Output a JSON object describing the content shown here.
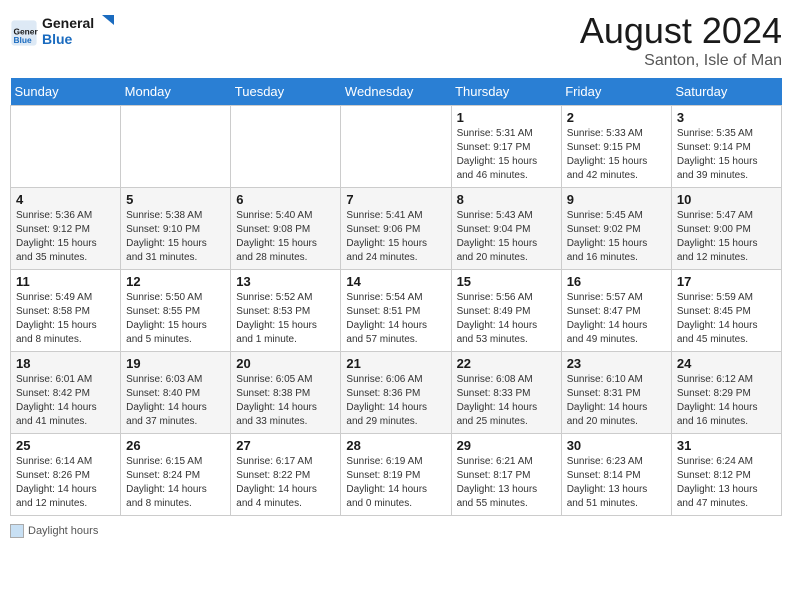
{
  "header": {
    "logo_line1": "General",
    "logo_line2": "Blue",
    "month_title": "August 2024",
    "subtitle": "Santon, Isle of Man"
  },
  "days_of_week": [
    "Sunday",
    "Monday",
    "Tuesday",
    "Wednesday",
    "Thursday",
    "Friday",
    "Saturday"
  ],
  "weeks": [
    [
      {
        "day": "",
        "info": ""
      },
      {
        "day": "",
        "info": ""
      },
      {
        "day": "",
        "info": ""
      },
      {
        "day": "",
        "info": ""
      },
      {
        "day": "1",
        "info": "Sunrise: 5:31 AM\nSunset: 9:17 PM\nDaylight: 15 hours\nand 46 minutes."
      },
      {
        "day": "2",
        "info": "Sunrise: 5:33 AM\nSunset: 9:15 PM\nDaylight: 15 hours\nand 42 minutes."
      },
      {
        "day": "3",
        "info": "Sunrise: 5:35 AM\nSunset: 9:14 PM\nDaylight: 15 hours\nand 39 minutes."
      }
    ],
    [
      {
        "day": "4",
        "info": "Sunrise: 5:36 AM\nSunset: 9:12 PM\nDaylight: 15 hours\nand 35 minutes."
      },
      {
        "day": "5",
        "info": "Sunrise: 5:38 AM\nSunset: 9:10 PM\nDaylight: 15 hours\nand 31 minutes."
      },
      {
        "day": "6",
        "info": "Sunrise: 5:40 AM\nSunset: 9:08 PM\nDaylight: 15 hours\nand 28 minutes."
      },
      {
        "day": "7",
        "info": "Sunrise: 5:41 AM\nSunset: 9:06 PM\nDaylight: 15 hours\nand 24 minutes."
      },
      {
        "day": "8",
        "info": "Sunrise: 5:43 AM\nSunset: 9:04 PM\nDaylight: 15 hours\nand 20 minutes."
      },
      {
        "day": "9",
        "info": "Sunrise: 5:45 AM\nSunset: 9:02 PM\nDaylight: 15 hours\nand 16 minutes."
      },
      {
        "day": "10",
        "info": "Sunrise: 5:47 AM\nSunset: 9:00 PM\nDaylight: 15 hours\nand 12 minutes."
      }
    ],
    [
      {
        "day": "11",
        "info": "Sunrise: 5:49 AM\nSunset: 8:58 PM\nDaylight: 15 hours\nand 8 minutes."
      },
      {
        "day": "12",
        "info": "Sunrise: 5:50 AM\nSunset: 8:55 PM\nDaylight: 15 hours\nand 5 minutes."
      },
      {
        "day": "13",
        "info": "Sunrise: 5:52 AM\nSunset: 8:53 PM\nDaylight: 15 hours\nand 1 minute."
      },
      {
        "day": "14",
        "info": "Sunrise: 5:54 AM\nSunset: 8:51 PM\nDaylight: 14 hours\nand 57 minutes."
      },
      {
        "day": "15",
        "info": "Sunrise: 5:56 AM\nSunset: 8:49 PM\nDaylight: 14 hours\nand 53 minutes."
      },
      {
        "day": "16",
        "info": "Sunrise: 5:57 AM\nSunset: 8:47 PM\nDaylight: 14 hours\nand 49 minutes."
      },
      {
        "day": "17",
        "info": "Sunrise: 5:59 AM\nSunset: 8:45 PM\nDaylight: 14 hours\nand 45 minutes."
      }
    ],
    [
      {
        "day": "18",
        "info": "Sunrise: 6:01 AM\nSunset: 8:42 PM\nDaylight: 14 hours\nand 41 minutes."
      },
      {
        "day": "19",
        "info": "Sunrise: 6:03 AM\nSunset: 8:40 PM\nDaylight: 14 hours\nand 37 minutes."
      },
      {
        "day": "20",
        "info": "Sunrise: 6:05 AM\nSunset: 8:38 PM\nDaylight: 14 hours\nand 33 minutes."
      },
      {
        "day": "21",
        "info": "Sunrise: 6:06 AM\nSunset: 8:36 PM\nDaylight: 14 hours\nand 29 minutes."
      },
      {
        "day": "22",
        "info": "Sunrise: 6:08 AM\nSunset: 8:33 PM\nDaylight: 14 hours\nand 25 minutes."
      },
      {
        "day": "23",
        "info": "Sunrise: 6:10 AM\nSunset: 8:31 PM\nDaylight: 14 hours\nand 20 minutes."
      },
      {
        "day": "24",
        "info": "Sunrise: 6:12 AM\nSunset: 8:29 PM\nDaylight: 14 hours\nand 16 minutes."
      }
    ],
    [
      {
        "day": "25",
        "info": "Sunrise: 6:14 AM\nSunset: 8:26 PM\nDaylight: 14 hours\nand 12 minutes."
      },
      {
        "day": "26",
        "info": "Sunrise: 6:15 AM\nSunset: 8:24 PM\nDaylight: 14 hours\nand 8 minutes."
      },
      {
        "day": "27",
        "info": "Sunrise: 6:17 AM\nSunset: 8:22 PM\nDaylight: 14 hours\nand 4 minutes."
      },
      {
        "day": "28",
        "info": "Sunrise: 6:19 AM\nSunset: 8:19 PM\nDaylight: 14 hours\nand 0 minutes."
      },
      {
        "day": "29",
        "info": "Sunrise: 6:21 AM\nSunset: 8:17 PM\nDaylight: 13 hours\nand 55 minutes."
      },
      {
        "day": "30",
        "info": "Sunrise: 6:23 AM\nSunset: 8:14 PM\nDaylight: 13 hours\nand 51 minutes."
      },
      {
        "day": "31",
        "info": "Sunrise: 6:24 AM\nSunset: 8:12 PM\nDaylight: 13 hours\nand 47 minutes."
      }
    ]
  ],
  "footer": {
    "daylight_label": "Daylight hours"
  }
}
